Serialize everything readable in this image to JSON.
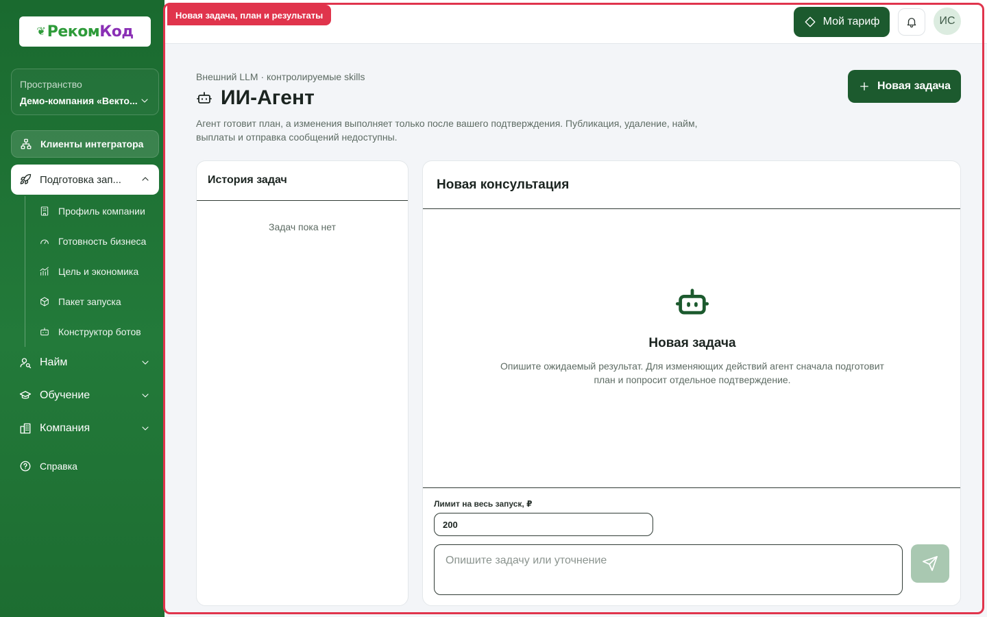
{
  "app": {
    "logo_text": "РекомКод",
    "badge": "Новая задача, план и результаты"
  },
  "sidebar": {
    "space_label": "Пространство",
    "space_name": "Демо-компания «Векто...",
    "clients": {
      "label": "Клиенты интегратора",
      "icon": "users-network-icon"
    },
    "prep": {
      "label": "Подготовка зап...",
      "icon": "rocket-icon"
    },
    "subitems": [
      {
        "label": "Профиль компании",
        "icon": "building-icon"
      },
      {
        "label": "Готовность бизнеса",
        "icon": "gauge-icon"
      },
      {
        "label": "Цель и экономика",
        "icon": "chart-icon"
      },
      {
        "label": "Пакет запуска",
        "icon": "package-icon"
      },
      {
        "label": "Конструктор ботов",
        "icon": "bot-icon"
      }
    ],
    "groups": [
      {
        "label": "Найм",
        "icon": "user-search-icon"
      },
      {
        "label": "Обучение",
        "icon": "graduation-cap-icon"
      },
      {
        "label": "Компания",
        "icon": "office-icon"
      }
    ],
    "help": {
      "label": "Справка",
      "icon": "help-circle-icon"
    }
  },
  "header": {
    "tariff_label": "Мой тариф",
    "avatar_initials": "ИС"
  },
  "page": {
    "eyebrow": "Внешний LLM · контролируемые skills",
    "title": "ИИ-Агент",
    "description": "Агент готовит план, а изменения выполняет только после вашего подтверждения. Публикация, удаление, найм, выплаты и отправка сообщений недоступны.",
    "new_task_label": "Новая задача"
  },
  "history": {
    "title": "История задач",
    "empty": "Задач пока нет"
  },
  "consult": {
    "title": "Новая консультация",
    "empty_title": "Новая задача",
    "empty_desc": "Опишите ожидаемый результат. Для изменяющих действий агент сначала подготовит план и попросит отдельное подтверждение.",
    "limit_label": "Лимит на весь запуск, ₽",
    "limit_value": "200",
    "task_placeholder": "Опишите задачу или уточнение"
  },
  "colors": {
    "brand_green": "#1c5a2e",
    "sidebar_green": "#1f6f34",
    "highlight_red": "#e0344c",
    "send_disabled": "#a9c8b1"
  }
}
